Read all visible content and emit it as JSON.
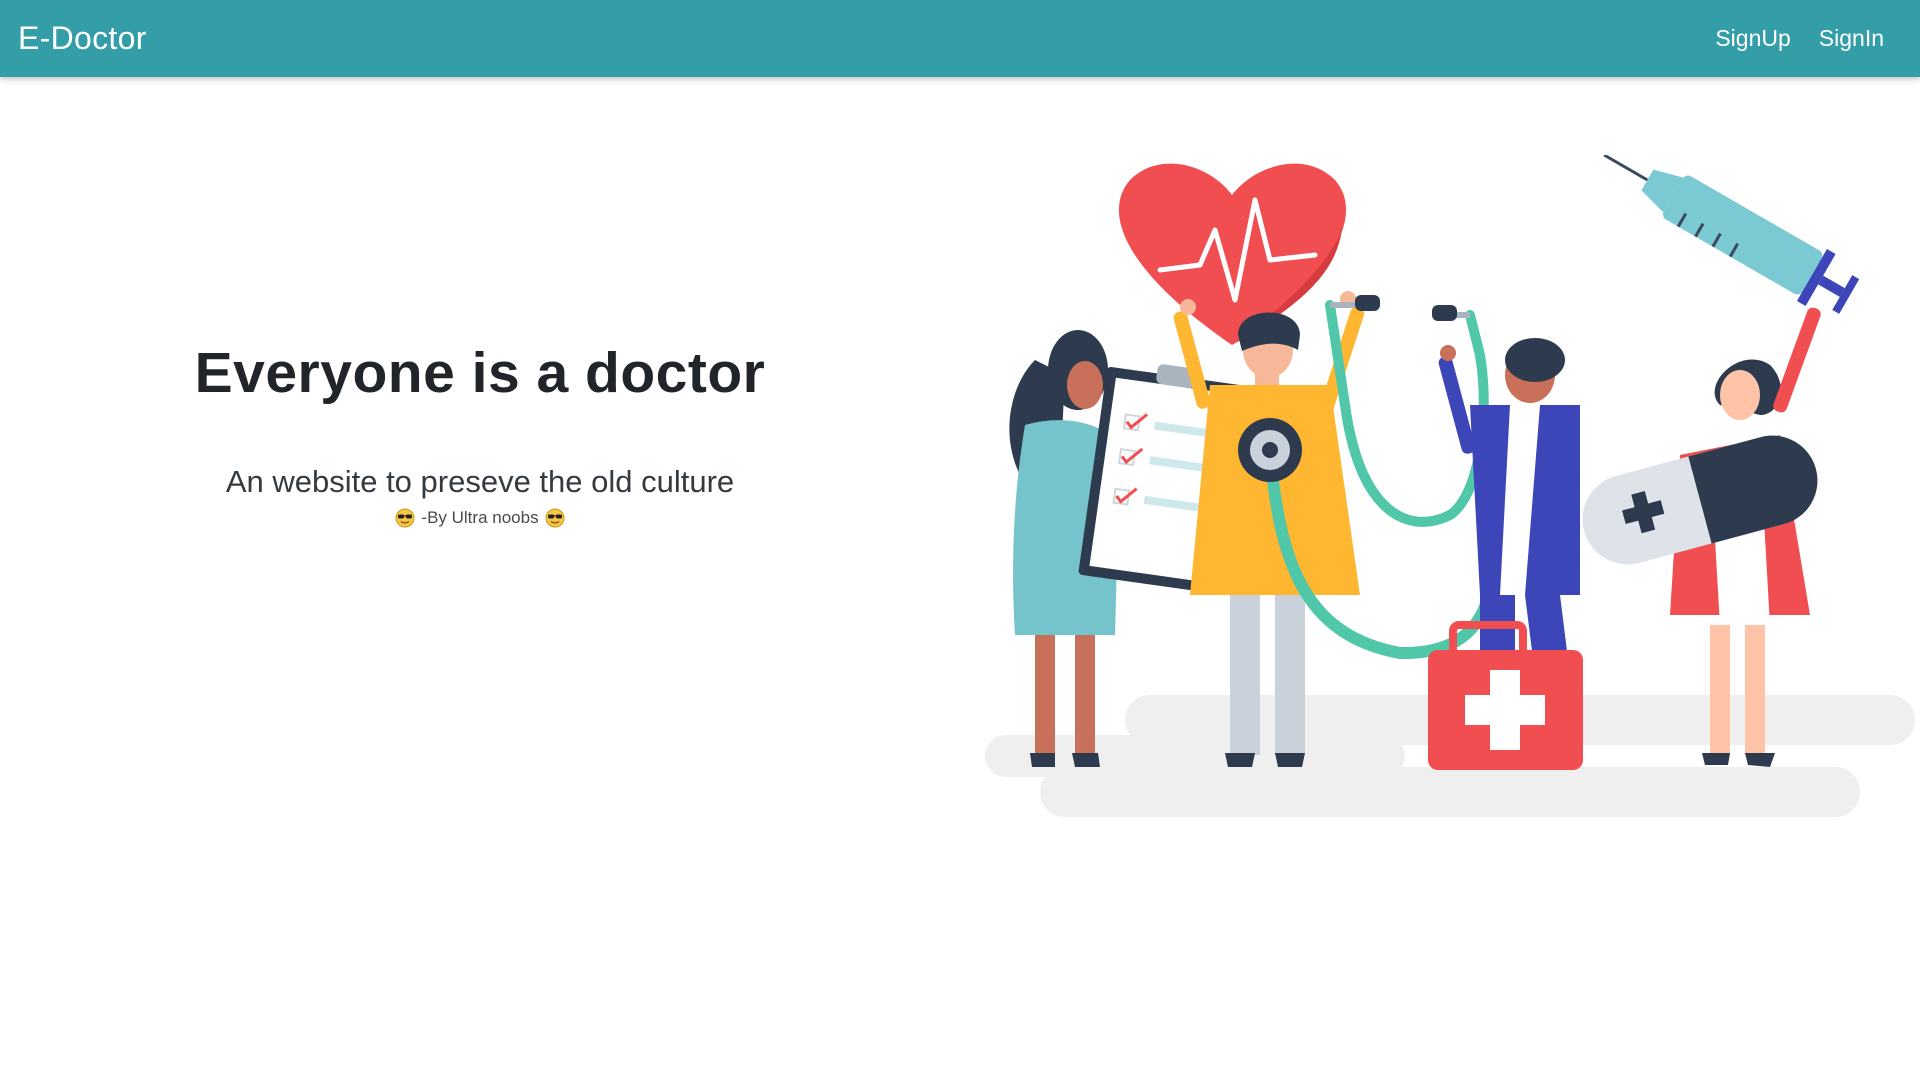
{
  "navbar": {
    "brand": "E-Doctor",
    "links": [
      {
        "label": "SignUp"
      },
      {
        "label": "SignIn"
      }
    ],
    "colors": {
      "background": "#339ea8",
      "text": "#ffffff"
    }
  },
  "hero": {
    "title": "Everyone is a doctor",
    "subtitle": "An website to preseve the old culture",
    "credit": "-By Ultra noobs",
    "credit_icon": "sunglasses-face-emoji"
  },
  "illustration": {
    "icon": "medical-team-illustration",
    "elements": [
      "heart-icon",
      "syringe-icon",
      "clipboard-icon",
      "stethoscope-icon",
      "first-aid-kit-icon",
      "pill-icon"
    ]
  }
}
